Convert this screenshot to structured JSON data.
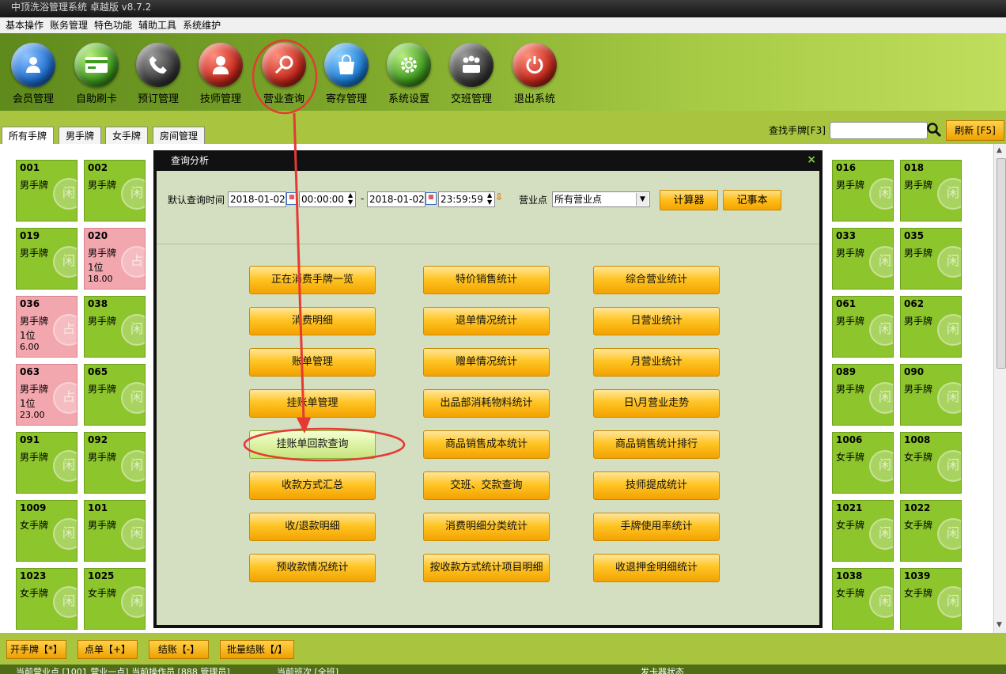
{
  "app": {
    "title": "中顶洗浴管理系统 卓越版 v8.7.2"
  },
  "menu": [
    "基本操作",
    "账务管理",
    "特色功能",
    "辅助工具",
    "系统维护"
  ],
  "toolbar": [
    {
      "label": "会员管理",
      "icon": "member-icon",
      "color": "#1f6fd0"
    },
    {
      "label": "自助刷卡",
      "icon": "card-icon",
      "color": "#3f9a1e"
    },
    {
      "label": "预订管理",
      "icon": "phone-icon",
      "color": "#3a3a3a"
    },
    {
      "label": "技师管理",
      "icon": "technician-icon",
      "color": "#c62a1c"
    },
    {
      "label": "营业查询",
      "icon": "magnifier-icon",
      "color": "#c62a1c"
    },
    {
      "label": "寄存管理",
      "icon": "bag-icon",
      "color": "#1d7fd6"
    },
    {
      "label": "系统设置",
      "icon": "gear-icon",
      "color": "#3f9a1e"
    },
    {
      "label": "交班管理",
      "icon": "meeting-icon",
      "color": "#3a3a3a"
    },
    {
      "label": "退出系统",
      "icon": "power-icon",
      "color": "#c62a1c"
    }
  ],
  "tabs": [
    "所有手牌",
    "男手牌",
    "女手牌",
    "房间管理"
  ],
  "search": {
    "label": "查找手牌[F3]",
    "value": "",
    "refresh": "刷新 [F5]"
  },
  "cards": [
    {
      "num": "001",
      "type": "男手牌"
    },
    {
      "num": "002",
      "type": "男手牌"
    },
    {
      "num": "016",
      "type": "男手牌"
    },
    {
      "num": "018",
      "type": "男手牌"
    },
    {
      "num": "019",
      "type": "男手牌"
    },
    {
      "num": "020",
      "type": "男手牌",
      "count": "1位",
      "amount": "18.00",
      "occupied": true
    },
    {
      "num": "033",
      "type": "男手牌"
    },
    {
      "num": "035",
      "type": "男手牌"
    },
    {
      "num": "036",
      "type": "男手牌",
      "count": "1位",
      "amount": "6.00",
      "occupied": true
    },
    {
      "num": "038",
      "type": "男手牌"
    },
    {
      "num": "061",
      "type": "男手牌"
    },
    {
      "num": "062",
      "type": "男手牌"
    },
    {
      "num": "063",
      "type": "男手牌",
      "count": "1位",
      "amount": "23.00",
      "occupied": true
    },
    {
      "num": "065",
      "type": "男手牌"
    },
    {
      "num": "089",
      "type": "男手牌"
    },
    {
      "num": "090",
      "type": "男手牌"
    },
    {
      "num": "091",
      "type": "男手牌"
    },
    {
      "num": "092",
      "type": "男手牌"
    },
    {
      "num": "1006",
      "type": "女手牌"
    },
    {
      "num": "1008",
      "type": "女手牌"
    },
    {
      "num": "1009",
      "type": "女手牌"
    },
    {
      "num": "101",
      "type": "男手牌"
    },
    {
      "num": "1021",
      "type": "女手牌"
    },
    {
      "num": "1022",
      "type": "女手牌"
    },
    {
      "num": "1023",
      "type": "女手牌"
    },
    {
      "num": "1025",
      "type": "女手牌"
    },
    {
      "num": "1038",
      "type": "女手牌"
    },
    {
      "num": "1039",
      "type": "女手牌"
    }
  ],
  "card_watermark": {
    "free": "闲",
    "occupied": "占"
  },
  "bottom_buttons": [
    "开手牌【*】",
    "点单【+】",
    "结账【-】",
    "批量结账【/】"
  ],
  "status": {
    "left": "当前营业点 [1001 营业一点] 当前操作员 [888 管理员]",
    "shift": "当前班次 [全班]",
    "card_reader": "发卡器状态"
  },
  "dialog": {
    "title": "查询分析",
    "close": "×",
    "time_label": "默认查询时间",
    "start_date": "2018-01-02",
    "start_time": "00:00:00",
    "dash": "-",
    "end_date": "2018-01-02",
    "end_time": "23:59:59",
    "location_label": "营业点",
    "location_value": "所有营业点",
    "calc_button": "计算器",
    "notepad_button": "记事本",
    "columns": [
      [
        "正在消费手牌一览",
        "消费明细",
        "账单管理",
        "挂账单管理",
        "挂账单回款查询",
        "收款方式汇总",
        "收/退款明细",
        "预收款情况统计"
      ],
      [
        "特价销售统计",
        "退单情况统计",
        "赠单情况统计",
        "出品部消耗物料统计",
        "商品销售成本统计",
        "交班、交款查询",
        "消费明细分类统计",
        "按收款方式统计项目明细"
      ],
      [
        "综合营业统计",
        "日营业统计",
        "月营业统计",
        "日\\月营业走势",
        "商品销售统计排行",
        "技师提成统计",
        "手牌使用率统计",
        "收退押金明细统计"
      ]
    ],
    "highlighted": "挂账单回款查询"
  }
}
